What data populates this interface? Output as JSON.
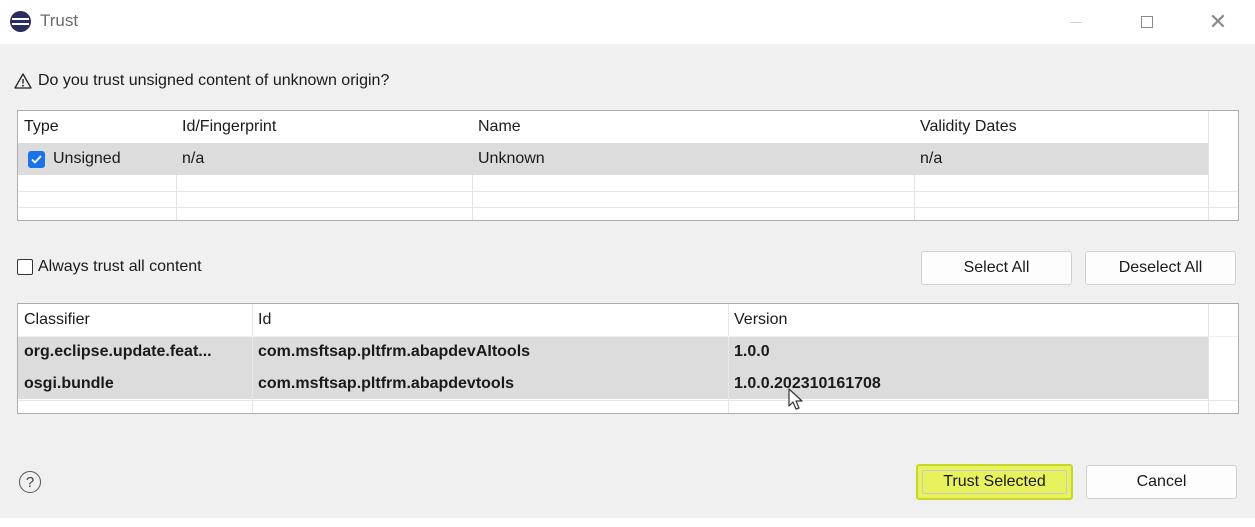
{
  "window": {
    "title": "Trust",
    "app_icon": "eclipse-icon",
    "controls": [
      "minimize-icon",
      "maximize-icon",
      "close-icon"
    ]
  },
  "question": {
    "icon": "warning-icon",
    "text": "Do you trust unsigned content of unknown origin?"
  },
  "signers_table": {
    "columns": [
      "Type",
      "Id/Fingerprint",
      "Name",
      "Validity Dates"
    ],
    "rows": [
      {
        "checked": true,
        "type": "Unsigned",
        "id": "n/a",
        "name": "Unknown",
        "validity": "n/a"
      }
    ]
  },
  "always_trust": {
    "label": "Always trust all content",
    "checked": false
  },
  "buttons": {
    "select_all": "Select All",
    "deselect_all": "Deselect All",
    "trust_selected": "Trust Selected",
    "cancel": "Cancel"
  },
  "artifacts_table": {
    "columns": [
      "Classifier",
      "Id",
      "Version"
    ],
    "rows": [
      {
        "classifier": "org.eclipse.update.feat...",
        "id": "com.msftsap.pltfrm.abapdevAItools",
        "version": "1.0.0"
      },
      {
        "classifier": "osgi.bundle",
        "id": "com.msftsap.pltfrm.abapdevtools",
        "version": "1.0.0.202310161708"
      }
    ]
  },
  "colors": {
    "checkbox_accent": "#1a73e8",
    "highlight": "#e8f25c",
    "selected_row": "#dcdcdc"
  }
}
